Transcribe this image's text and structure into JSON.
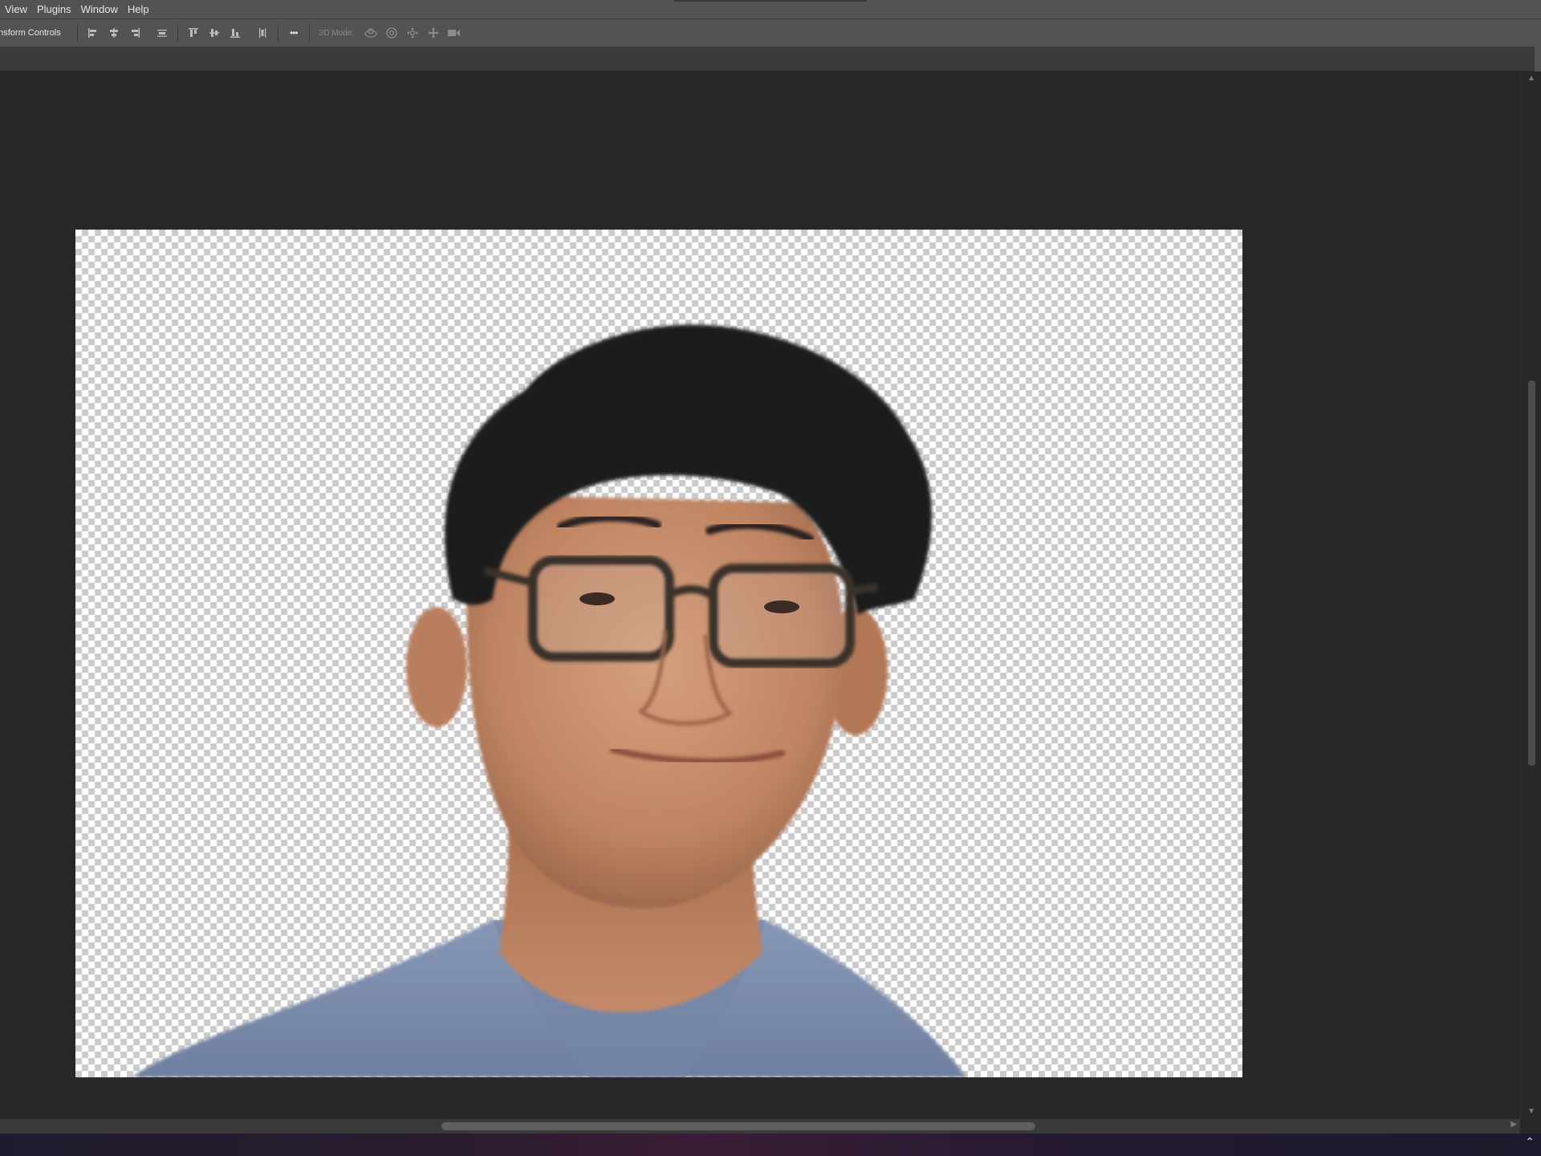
{
  "menubar": {
    "items": [
      "View",
      "Plugins",
      "Window",
      "Help"
    ]
  },
  "options": {
    "transform_label": "ansform Controls",
    "mode_label": "3D Mode:",
    "more_label": "•••"
  },
  "colors": {
    "chrome": "#535353",
    "workspace": "#282828",
    "shirt": "#7d8fb0",
    "skin": "#c8906e",
    "hair": "#1f1b1a"
  },
  "icons": [
    "align-left-edges-icon",
    "align-horizontal-centers-icon",
    "align-right-edges-icon",
    "distribute-vertical-icon",
    "align-top-edges-icon",
    "align-vertical-centers-icon",
    "align-bottom-edges-icon",
    "distribute-horizontal-icon",
    "more-options-icon",
    "orbit-3d-icon",
    "roll-3d-icon",
    "pan-3d-icon",
    "slide-3d-icon",
    "scale-3d-icon"
  ]
}
